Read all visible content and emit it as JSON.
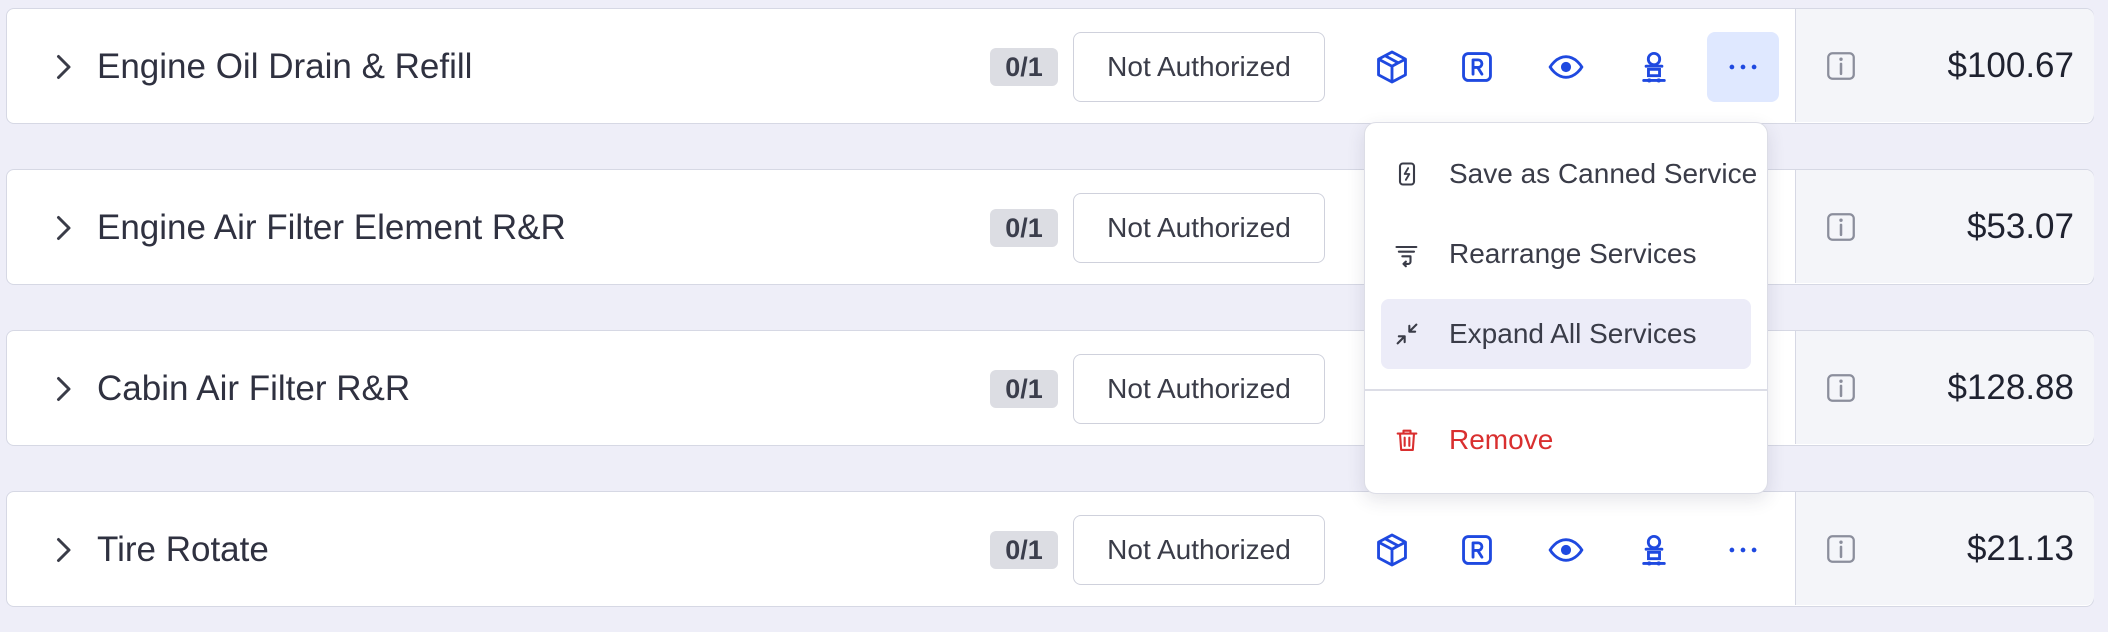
{
  "colors": {
    "accent": "#1f49e0",
    "danger": "#d92f2f",
    "menu_highlight": "#ececf8",
    "active_button": "#dfe8ff"
  },
  "rows": [
    {
      "title": "Engine Oil Drain & Refill",
      "count": "0/1",
      "status": "Not Authorized",
      "price": "$100.67",
      "menu_open": true
    },
    {
      "title": "Engine Air Filter Element R&R",
      "count": "0/1",
      "status": "Not Authorized",
      "price": "$53.07"
    },
    {
      "title": "Cabin Air Filter R&R",
      "count": "0/1",
      "status": "Not Authorized",
      "price": "$128.88"
    },
    {
      "title": "Tire Rotate",
      "count": "0/1",
      "status": "Not Authorized",
      "price": "$21.13"
    }
  ],
  "row_icons": [
    "chevron-right-icon",
    "box-icon",
    "r-badge-icon",
    "eye-icon",
    "technician-icon",
    "more-dots-icon",
    "info-icon"
  ],
  "menu": {
    "items": [
      {
        "label": "Save as Canned Service",
        "icon": "canned-service-icon"
      },
      {
        "label": "Rearrange Services",
        "icon": "rearrange-icon"
      },
      {
        "label": "Expand All Services",
        "icon": "expand-icon",
        "highlighted": true
      },
      {
        "label": "Remove",
        "icon": "trash-icon",
        "danger": true
      }
    ]
  }
}
